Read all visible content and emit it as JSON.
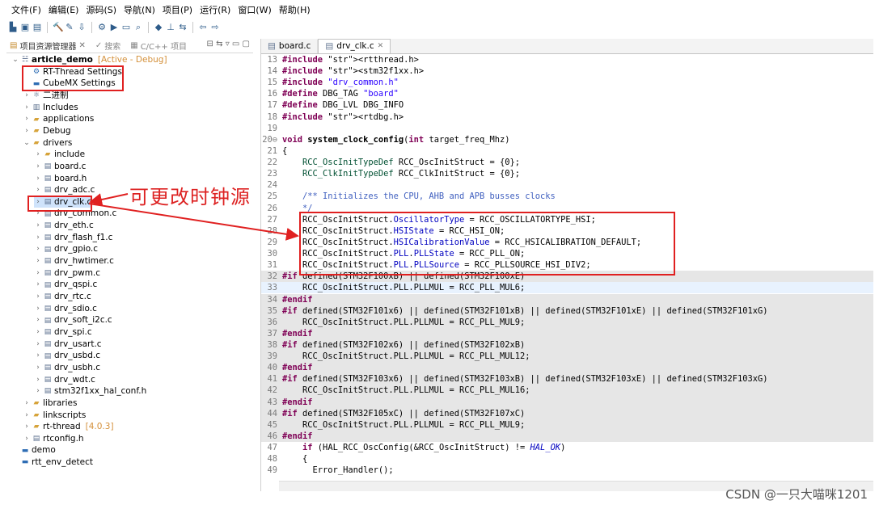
{
  "menu": [
    "文件(F)",
    "编辑(E)",
    "源码(S)",
    "导航(N)",
    "项目(P)",
    "运行(R)",
    "窗口(W)",
    "帮助(H)"
  ],
  "left_tabs": {
    "explorer": "项目资源管理器",
    "search": "搜索",
    "cproj": "C/C++ 项目"
  },
  "tree": [
    {
      "label": "article_demo",
      "extra": "[Active - Debug]",
      "depth": 0,
      "icon": "project",
      "open": true
    },
    {
      "label": "RT-Thread Settings",
      "depth": 1,
      "icon": "settings"
    },
    {
      "label": "CubeMX Settings",
      "depth": 1,
      "icon": "cubemx"
    },
    {
      "label": "二进制",
      "depth": 1,
      "icon": "binary",
      "closed": true
    },
    {
      "label": "Includes",
      "depth": 1,
      "icon": "includes",
      "closed": true
    },
    {
      "label": "applications",
      "depth": 1,
      "icon": "folder",
      "closed": true
    },
    {
      "label": "Debug",
      "depth": 1,
      "icon": "folder",
      "closed": true
    },
    {
      "label": "drivers",
      "depth": 1,
      "icon": "folder",
      "open": true
    },
    {
      "label": "include",
      "depth": 2,
      "icon": "folder",
      "closed": true
    },
    {
      "label": "board.c",
      "depth": 2,
      "icon": "cfile",
      "closed": true
    },
    {
      "label": "board.h",
      "depth": 2,
      "icon": "hfile",
      "closed": true
    },
    {
      "label": "drv_adc.c",
      "depth": 2,
      "icon": "cfile",
      "closed": true
    },
    {
      "label": "drv_clk.c",
      "depth": 2,
      "icon": "cfile",
      "closed": true,
      "selected": true
    },
    {
      "label": "drv_common.c",
      "depth": 2,
      "icon": "cfile",
      "closed": true
    },
    {
      "label": "drv_eth.c",
      "depth": 2,
      "icon": "cfile",
      "closed": true
    },
    {
      "label": "drv_flash_f1.c",
      "depth": 2,
      "icon": "cfile",
      "closed": true
    },
    {
      "label": "drv_gpio.c",
      "depth": 2,
      "icon": "cfile",
      "closed": true
    },
    {
      "label": "drv_hwtimer.c",
      "depth": 2,
      "icon": "cfile",
      "closed": true
    },
    {
      "label": "drv_pwm.c",
      "depth": 2,
      "icon": "cfile",
      "closed": true
    },
    {
      "label": "drv_qspi.c",
      "depth": 2,
      "icon": "cfile",
      "closed": true
    },
    {
      "label": "drv_rtc.c",
      "depth": 2,
      "icon": "cfile",
      "closed": true
    },
    {
      "label": "drv_sdio.c",
      "depth": 2,
      "icon": "cfile",
      "closed": true
    },
    {
      "label": "drv_soft_i2c.c",
      "depth": 2,
      "icon": "cfile",
      "closed": true
    },
    {
      "label": "drv_spi.c",
      "depth": 2,
      "icon": "cfile",
      "closed": true
    },
    {
      "label": "drv_usart.c",
      "depth": 2,
      "icon": "cfile",
      "closed": true
    },
    {
      "label": "drv_usbd.c",
      "depth": 2,
      "icon": "cfile",
      "closed": true
    },
    {
      "label": "drv_usbh.c",
      "depth": 2,
      "icon": "cfile",
      "closed": true
    },
    {
      "label": "drv_wdt.c",
      "depth": 2,
      "icon": "cfile",
      "closed": true
    },
    {
      "label": "stm32f1xx_hal_conf.h",
      "depth": 2,
      "icon": "hfile",
      "closed": true
    },
    {
      "label": "libraries",
      "depth": 1,
      "icon": "folder",
      "closed": true
    },
    {
      "label": "linkscripts",
      "depth": 1,
      "icon": "folder",
      "closed": true
    },
    {
      "label": "rt-thread",
      "extra": "[4.0.3]",
      "depth": 1,
      "icon": "folder",
      "closed": true
    },
    {
      "label": "rtconfig.h",
      "depth": 1,
      "icon": "hfile",
      "closed": true
    },
    {
      "label": "demo",
      "depth": 0,
      "icon": "project-closed"
    },
    {
      "label": "rtt_env_detect",
      "depth": 0,
      "icon": "project-closed"
    }
  ],
  "editor_tabs": [
    {
      "label": "board.c",
      "active": false
    },
    {
      "label": "drv_clk.c",
      "active": true
    }
  ],
  "code_lines": [
    {
      "n": "13",
      "t": "#include <rtthread.h>"
    },
    {
      "n": "14",
      "t": "#include <stm32f1xx.h>"
    },
    {
      "n": "15",
      "t": "#include \"drv_common.h\""
    },
    {
      "n": "16",
      "t": "#define DBG_TAG \"board\""
    },
    {
      "n": "17",
      "t": "#define DBG_LVL DBG_INFO"
    },
    {
      "n": "18",
      "t": "#include <rtdbg.h>"
    },
    {
      "n": "19",
      "t": ""
    },
    {
      "n": "20⊖",
      "t": "void system_clock_config(int target_freq_Mhz)"
    },
    {
      "n": "21",
      "t": "{"
    },
    {
      "n": "22",
      "t": "    RCC_OscInitTypeDef RCC_OscInitStruct = {0};"
    },
    {
      "n": "23",
      "t": "    RCC_ClkInitTypeDef RCC_ClkInitStruct = {0};"
    },
    {
      "n": "24",
      "t": ""
    },
    {
      "n": "25",
      "t": "    /** Initializes the CPU, AHB and APB busses clocks"
    },
    {
      "n": "26",
      "t": "    */"
    },
    {
      "n": "27",
      "t": "    RCC_OscInitStruct.OscillatorType = RCC_OSCILLATORTYPE_HSI;"
    },
    {
      "n": "28",
      "t": "    RCC_OscInitStruct.HSIState = RCC_HSI_ON;"
    },
    {
      "n": "29",
      "t": "    RCC_OscInitStruct.HSICalibrationValue = RCC_HSICALIBRATION_DEFAULT;"
    },
    {
      "n": "30",
      "t": "    RCC_OscInitStruct.PLL.PLLState = RCC_PLL_ON;"
    },
    {
      "n": "31",
      "t": "    RCC_OscInitStruct.PLL.PLLSource = RCC_PLLSOURCE_HSI_DIV2;"
    },
    {
      "n": "32",
      "t": "#if defined(STM32F100xB) || defined(STM32F100xE)"
    },
    {
      "n": "33",
      "t": "    RCC_OscInitStruct.PLL.PLLMUL = RCC_PLL_MUL6;"
    },
    {
      "n": "34",
      "t": "#endif"
    },
    {
      "n": "35",
      "t": "#if defined(STM32F101x6) || defined(STM32F101xB) || defined(STM32F101xE) || defined(STM32F101xG)"
    },
    {
      "n": "36",
      "t": "    RCC_OscInitStruct.PLL.PLLMUL = RCC_PLL_MUL9;"
    },
    {
      "n": "37",
      "t": "#endif"
    },
    {
      "n": "38",
      "t": "#if defined(STM32F102x6) || defined(STM32F102xB)"
    },
    {
      "n": "39",
      "t": "    RCC_OscInitStruct.PLL.PLLMUL = RCC_PLL_MUL12;"
    },
    {
      "n": "40",
      "t": "#endif"
    },
    {
      "n": "41",
      "t": "#if defined(STM32F103x6) || defined(STM32F103xB) || defined(STM32F103xE) || defined(STM32F103xG)"
    },
    {
      "n": "42",
      "t": "    RCC_OscInitStruct.PLL.PLLMUL = RCC_PLL_MUL16;"
    },
    {
      "n": "43",
      "t": "#endif"
    },
    {
      "n": "44",
      "t": "#if defined(STM32F105xC) || defined(STM32F107xC)"
    },
    {
      "n": "45",
      "t": "    RCC_OscInitStruct.PLL.PLLMUL = RCC_PLL_MUL9;"
    },
    {
      "n": "46",
      "t": "#endif"
    },
    {
      "n": "47",
      "t": "    if (HAL_RCC_OscConfig(&RCC_OscInitStruct) != HAL_OK)"
    },
    {
      "n": "48",
      "t": "    {"
    },
    {
      "n": "49",
      "t": "      Error_Handler();"
    }
  ],
  "annotation": "可更改时钟源",
  "watermark": "CSDN @一只大喵咪1201",
  "colors": {
    "annotation_red": "#e02020",
    "selection": "#cfe3fb"
  }
}
